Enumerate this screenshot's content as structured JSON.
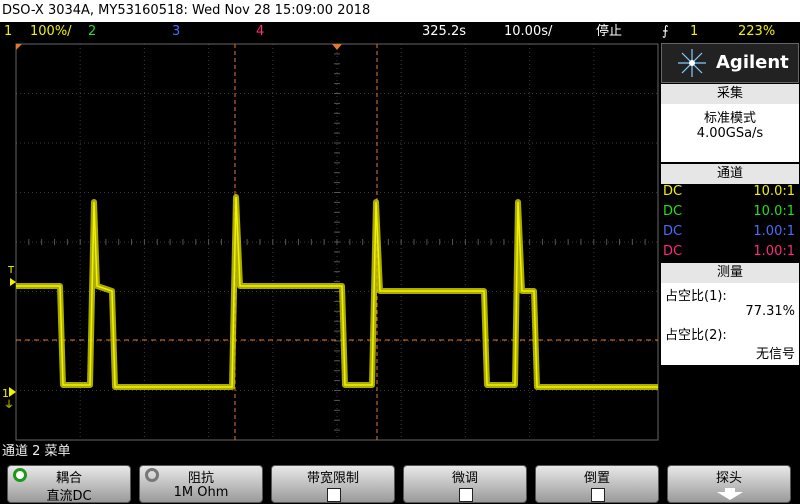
{
  "title": "DSO-X 3034A, MY53160518: Wed Nov 28 15:09:00 2018",
  "status": {
    "ch1_num": "1",
    "ch1_scale": "100%/",
    "ch2_num": "2",
    "ch3_num": "3",
    "ch4_num": "4",
    "time_pos": "325.2s",
    "time_scale": "10.00s/",
    "run_state": "停止",
    "trig_icon": "trigger-edge-icon",
    "trig_src": "1",
    "trig_level": "223%"
  },
  "panel": {
    "brand": "Agilent",
    "acq_head": "采集",
    "acq_mode": "标准模式",
    "acq_rate": "4.00GSa/s",
    "chan_head": "通道",
    "channels": [
      {
        "coupling": "DC",
        "probe": "10.0:1",
        "color": "#f2f200"
      },
      {
        "coupling": "DC",
        "probe": "10.0:1",
        "color": "#22e022"
      },
      {
        "coupling": "DC",
        "probe": "1.00:1",
        "color": "#4a6cff"
      },
      {
        "coupling": "DC",
        "probe": "1.00:1",
        "color": "#ff2a7a"
      }
    ],
    "meas_head": "测量",
    "meas1_label": "占空比(1):",
    "meas1_value": "77.31%",
    "meas2_label": "占空比(2):",
    "meas2_value": "无信号"
  },
  "markers": {
    "trig_marker": "T",
    "ch1_ground": "1"
  },
  "bottom_label": "通道 2 菜单",
  "softkeys": {
    "coupling_title": "耦合",
    "coupling_value": "直流DC",
    "impedance_title": "阻抗",
    "impedance_value": "1M Ohm",
    "bw_limit_title": "带宽限制",
    "fine_title": "微调",
    "invert_title": "倒置",
    "probe_title": "探头"
  },
  "colors": {
    "ch1": "#f2f200",
    "ch2": "#22e022",
    "ch3": "#4a6cff",
    "ch4": "#ff2a7a",
    "cursor": "#e07a2a",
    "grid": "#444444"
  }
}
